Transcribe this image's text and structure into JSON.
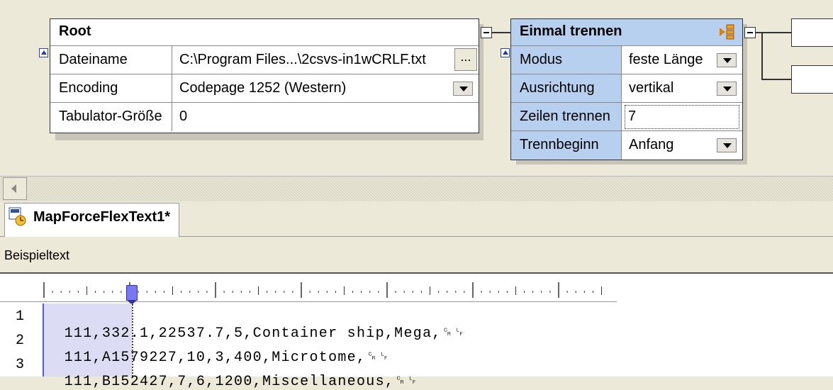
{
  "root_component": {
    "title": "Root",
    "rows": [
      {
        "label": "Dateiname",
        "value": "C:\\Program Files...\\2csvs-in1wCRLF.txt",
        "button": "..."
      },
      {
        "label": "Encoding",
        "value": "Codepage 1252 (Western)"
      },
      {
        "label": "Tabulator-Größe",
        "value": "0"
      }
    ]
  },
  "split_component": {
    "title": "Einmal trennen",
    "rows": [
      {
        "label": "Modus",
        "value": "feste Länge"
      },
      {
        "label": "Ausrichtung",
        "value": "vertikal"
      },
      {
        "label": "Zeilen trennen",
        "value": "7"
      },
      {
        "label": "Trennbeginn",
        "value": "Anfang"
      }
    ]
  },
  "tab": {
    "label": "MapForceFlexText1*"
  },
  "preview": {
    "section_label": "Beispieltext",
    "lines": [
      {
        "num": "1",
        "text": "111,332.1,22537.7,5,Container ship,Mega,"
      },
      {
        "num": "2",
        "text": "111,A1579227,10,3,400,Microtome,"
      },
      {
        "num": "3",
        "text": "111,B152427,7,6,1200,Miscellaneous,"
      }
    ],
    "crlf_glyph": "␍␊"
  },
  "colors": {
    "accent_blue": "#b8d0f0",
    "selection": "#dcdcf4",
    "background": "#ece9d8"
  }
}
